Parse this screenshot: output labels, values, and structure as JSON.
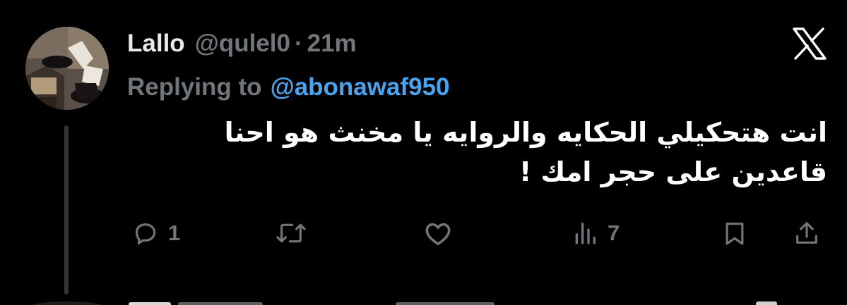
{
  "tweet": {
    "author": {
      "display_name": "Lallo",
      "handle": "@qulel0"
    },
    "separator": "·",
    "timestamp": "21m",
    "reply_prefix": "Replying to",
    "reply_mention": "@abonawaf950",
    "text": "انت هتحكيلي الحكايه والروايه يا مخنث هو احنا قاعدين على حجر امك !"
  },
  "actions": {
    "reply_count": "1",
    "views_count": "7"
  },
  "icons": {
    "logo": "x-logo-icon",
    "reply": "reply-icon",
    "retweet": "retweet-icon",
    "like": "heart-icon",
    "views": "views-icon",
    "bookmark": "bookmark-icon",
    "share": "share-icon"
  },
  "colors": {
    "background": "#000000",
    "text_primary": "#e7e9ea",
    "text_secondary": "#71767b",
    "link": "#4aa3ee"
  }
}
